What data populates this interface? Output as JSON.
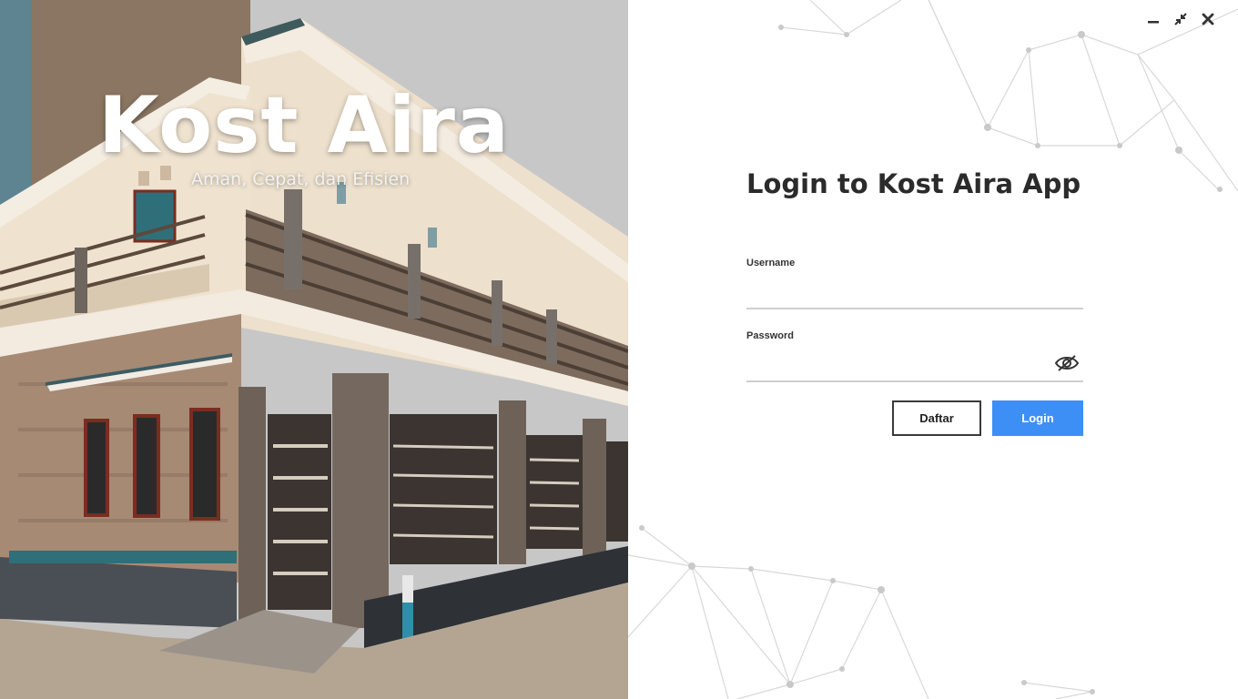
{
  "brand": {
    "title": "Kost Aira",
    "tagline": "Aman, Cepat, dan Efisien"
  },
  "window_controls": {
    "minimize_icon": "minimize-icon",
    "restore_icon": "restore-icon",
    "close_icon": "close-icon"
  },
  "login": {
    "title": "Login to Kost Aira App",
    "username_label": "Username",
    "username_value": "",
    "password_label": "Password",
    "password_value": "",
    "show_password_icon": "eye-slash-icon",
    "register_label": "Daftar",
    "login_label": "Login"
  },
  "colors": {
    "accent": "#3d8ff5",
    "title_text": "#2b2b2b",
    "underline": "#cfcfcf"
  }
}
